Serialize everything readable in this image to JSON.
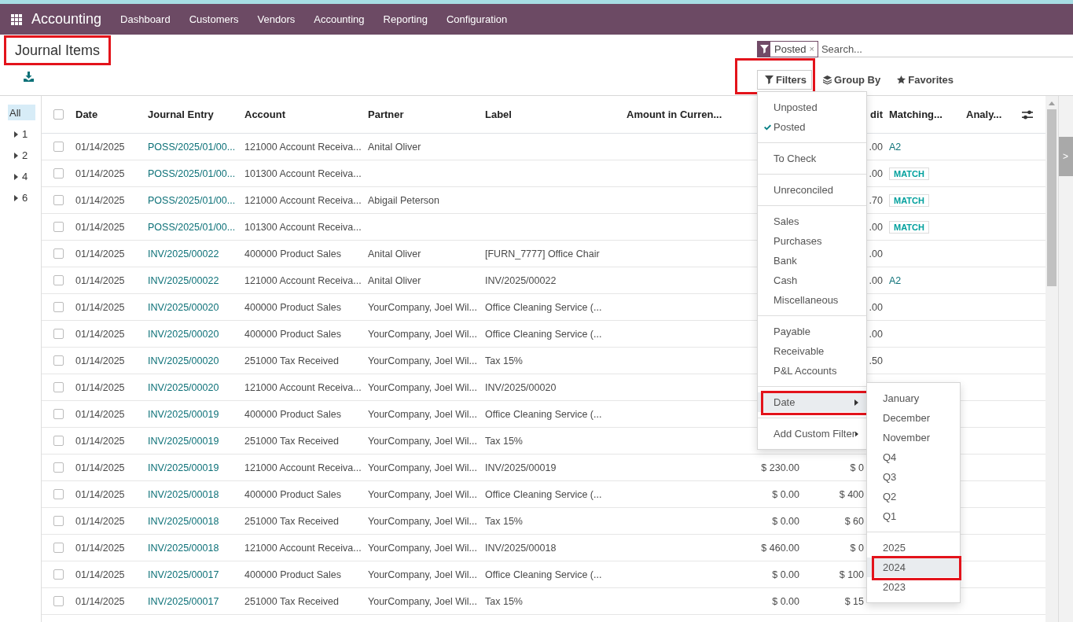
{
  "top_bar": {
    "app_name": "Accounting",
    "menu": [
      "Dashboard",
      "Customers",
      "Vendors",
      "Accounting",
      "Reporting",
      "Configuration"
    ]
  },
  "page_title": {
    "text": "Journal Items",
    "highlighted": true
  },
  "search": {
    "facets": [
      {
        "label": "Posted",
        "remove": "×"
      }
    ],
    "placeholder": "Search..."
  },
  "toolbar": {
    "buttons": [
      {
        "label": "Filters",
        "kind": "filter",
        "open": true,
        "highlighted": true
      },
      {
        "label": "Group By",
        "kind": "layers",
        "open": false,
        "highlighted": false
      },
      {
        "label": "Favorites",
        "kind": "star",
        "open": false,
        "highlighted": false
      }
    ]
  },
  "sidebar": {
    "items": [
      {
        "label": "All",
        "selected": true,
        "expandable": false
      },
      {
        "label": "1",
        "selected": false,
        "expandable": true
      },
      {
        "label": "2",
        "selected": false,
        "expandable": true
      },
      {
        "label": "4",
        "selected": false,
        "expandable": true
      },
      {
        "label": "6",
        "selected": false,
        "expandable": true
      }
    ]
  },
  "table": {
    "header_checked": false,
    "columns": [
      "Date",
      "Journal Entry",
      "Account",
      "Partner",
      "Label",
      "Amount in Curren...",
      "dit",
      "Matching...",
      "Analy..."
    ],
    "rows": [
      {
        "checked": false,
        "date": "01/14/2025",
        "journal_entry": "POSS/2025/01/00...",
        "account": "121000 Account Receiva...",
        "partner": "Anital Oliver",
        "credit": ".00",
        "matching": {
          "kind": "link",
          "text": "A2"
        }
      },
      {
        "checked": false,
        "date": "01/14/2025",
        "journal_entry": "POSS/2025/01/00...",
        "account": "101300 Account Receiva...",
        "credit": ".00",
        "matching": {
          "kind": "badge",
          "text": "MATCH"
        }
      },
      {
        "checked": false,
        "date": "01/14/2025",
        "journal_entry": "POSS/2025/01/00...",
        "account": "121000 Account Receiva...",
        "partner": "Abigail Peterson",
        "credit": ".70",
        "matching": {
          "kind": "badge",
          "text": "MATCH"
        }
      },
      {
        "checked": false,
        "date": "01/14/2025",
        "journal_entry": "POSS/2025/01/00...",
        "account": "101300 Account Receiva...",
        "credit": ".00",
        "matching": {
          "kind": "badge",
          "text": "MATCH"
        }
      },
      {
        "checked": false,
        "date": "01/14/2025",
        "journal_entry": "INV/2025/00022",
        "account": "400000 Product Sales",
        "partner": "Anital Oliver",
        "label": "[FURN_7777] Office Chair",
        "credit": ".00"
      },
      {
        "checked": false,
        "date": "01/14/2025",
        "journal_entry": "INV/2025/00022",
        "account": "121000 Account Receiva...",
        "partner": "Anital Oliver",
        "label": "INV/2025/00022",
        "credit": ".00",
        "matching": {
          "kind": "link",
          "text": "A2"
        }
      },
      {
        "checked": false,
        "date": "01/14/2025",
        "journal_entry": "INV/2025/00020",
        "account": "400000 Product Sales",
        "partner": "YourCompany, Joel Wil...",
        "label": "Office Cleaning Service (...",
        "credit": ".00"
      },
      {
        "checked": false,
        "date": "01/14/2025",
        "journal_entry": "INV/2025/00020",
        "account": "400000 Product Sales",
        "partner": "YourCompany, Joel Wil...",
        "label": "Office Cleaning Service (...",
        "credit": ".00"
      },
      {
        "checked": false,
        "date": "01/14/2025",
        "journal_entry": "INV/2025/00020",
        "account": "251000 Tax Received",
        "partner": "YourCompany, Joel Wil...",
        "label": "Tax 15%",
        "credit": ".50"
      },
      {
        "checked": false,
        "date": "01/14/2025",
        "journal_entry": "INV/2025/00020",
        "account": "121000 Account Receiva...",
        "partner": "YourCompany, Joel Wil...",
        "label": "INV/2025/00020"
      },
      {
        "checked": false,
        "date": "01/14/2025",
        "journal_entry": "INV/2025/00019",
        "account": "400000 Product Sales",
        "partner": "YourCompany, Joel Wil...",
        "label": "Office Cleaning Service (..."
      },
      {
        "checked": false,
        "date": "01/14/2025",
        "journal_entry": "INV/2025/00019",
        "account": "251000 Tax Received",
        "partner": "YourCompany, Joel Wil...",
        "label": "Tax 15%"
      },
      {
        "checked": false,
        "date": "01/14/2025",
        "journal_entry": "INV/2025/00019",
        "account": "121000 Account Receiva...",
        "partner": "YourCompany, Joel Wil...",
        "label": "INV/2025/00019",
        "amount": "$ 230.00",
        "credit": "$ 0"
      },
      {
        "checked": false,
        "date": "01/14/2025",
        "journal_entry": "INV/2025/00018",
        "account": "400000 Product Sales",
        "partner": "YourCompany, Joel Wil...",
        "label": "Office Cleaning Service (...",
        "amount": "$ 0.00",
        "credit": "$ 400"
      },
      {
        "checked": false,
        "date": "01/14/2025",
        "journal_entry": "INV/2025/00018",
        "account": "251000 Tax Received",
        "partner": "YourCompany, Joel Wil...",
        "label": "Tax 15%",
        "amount": "$ 0.00",
        "credit": "$ 60"
      },
      {
        "checked": false,
        "date": "01/14/2025",
        "journal_entry": "INV/2025/00018",
        "account": "121000 Account Receiva...",
        "partner": "YourCompany, Joel Wil...",
        "label": "INV/2025/00018",
        "amount": "$ 460.00",
        "credit": "$ 0"
      },
      {
        "checked": false,
        "date": "01/14/2025",
        "journal_entry": "INV/2025/00017",
        "account": "400000 Product Sales",
        "partner": "YourCompany, Joel Wil...",
        "label": "Office Cleaning Service (...",
        "amount": "$ 0.00",
        "credit": "$ 100"
      },
      {
        "checked": false,
        "date": "01/14/2025",
        "journal_entry": "INV/2025/00017",
        "account": "251000 Tax Received",
        "partner": "YourCompany, Joel Wil...",
        "label": "Tax 15%",
        "amount": "$ 0.00",
        "credit": "$ 15"
      }
    ]
  },
  "filters_menu": {
    "groups": [
      [
        {
          "label": "Unposted",
          "checked": false,
          "selected": false,
          "submenu": false,
          "highlighted": false
        },
        {
          "label": "Posted",
          "checked": true,
          "selected": false,
          "submenu": false,
          "highlighted": false
        }
      ],
      [
        {
          "label": "To Check",
          "checked": false,
          "selected": false,
          "submenu": false,
          "highlighted": false
        }
      ],
      [
        {
          "label": "Unreconciled",
          "checked": false,
          "selected": false,
          "submenu": false,
          "highlighted": false
        }
      ],
      [
        {
          "label": "Sales",
          "checked": false,
          "selected": false,
          "submenu": false,
          "highlighted": false
        },
        {
          "label": "Purchases",
          "checked": false,
          "selected": false,
          "submenu": false,
          "highlighted": false
        },
        {
          "label": "Bank",
          "checked": false,
          "selected": false,
          "submenu": false,
          "highlighted": false
        },
        {
          "label": "Cash",
          "checked": false,
          "selected": false,
          "submenu": false,
          "highlighted": false
        },
        {
          "label": "Miscellaneous",
          "checked": false,
          "selected": false,
          "submenu": false,
          "highlighted": false
        }
      ],
      [
        {
          "label": "Payable",
          "checked": false,
          "selected": false,
          "submenu": false,
          "highlighted": false
        },
        {
          "label": "Receivable",
          "checked": false,
          "selected": false,
          "submenu": false,
          "highlighted": false
        },
        {
          "label": "P&L Accounts",
          "checked": false,
          "selected": false,
          "submenu": false,
          "highlighted": false
        }
      ],
      [
        {
          "label": "Date",
          "checked": false,
          "selected": true,
          "submenu": true,
          "highlighted": true
        }
      ],
      [
        {
          "label": "Add Custom Filter",
          "checked": false,
          "selected": false,
          "submenu": true,
          "highlighted": false
        }
      ]
    ]
  },
  "date_submenu": {
    "groups": [
      [
        {
          "label": "January",
          "selected": false,
          "highlighted": false
        },
        {
          "label": "December",
          "selected": false,
          "highlighted": false
        },
        {
          "label": "November",
          "selected": false,
          "highlighted": false
        },
        {
          "label": "Q4",
          "selected": false,
          "highlighted": false
        },
        {
          "label": "Q3",
          "selected": false,
          "highlighted": false
        },
        {
          "label": "Q2",
          "selected": false,
          "highlighted": false
        },
        {
          "label": "Q1",
          "selected": false,
          "highlighted": false
        }
      ],
      [
        {
          "label": "2025",
          "selected": false,
          "highlighted": false
        },
        {
          "label": "2024",
          "selected": true,
          "highlighted": true
        },
        {
          "label": "2023",
          "selected": false,
          "highlighted": false
        }
      ]
    ]
  },
  "side_panel": {
    "tab": ">"
  }
}
